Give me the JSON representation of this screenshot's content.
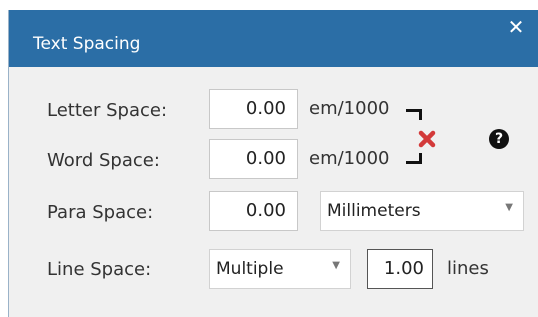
{
  "dialog": {
    "title": "Text Spacing",
    "close_glyph": "✕"
  },
  "fields": {
    "letter_space": {
      "label": "Letter Space:",
      "value": "0.00",
      "unit": "em/1000"
    },
    "word_space": {
      "label": "Word Space:",
      "value": "0.00",
      "unit": "em/1000"
    },
    "para_space": {
      "label": "Para Space:",
      "value": "0.00",
      "unit_selected": "Millimeters"
    },
    "line_space": {
      "label": "Line Space:",
      "mode_selected": "Multiple",
      "value": "1.00",
      "unit": "lines"
    }
  },
  "icons": {
    "unlink": "unlink-icon",
    "help": "help-icon",
    "help_glyph": "?",
    "dropdown_glyph": "▼"
  },
  "colors": {
    "titlebar": "#2b6ea6",
    "background": "#f0f0f0",
    "unlink_red": "#d33a3a"
  }
}
